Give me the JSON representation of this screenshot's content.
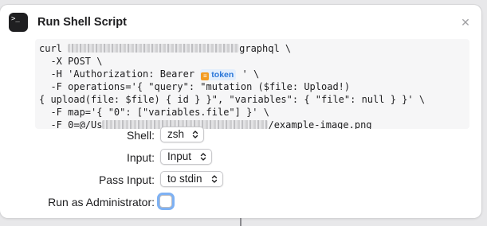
{
  "action": {
    "icon": "terminal-icon",
    "icon_glyph": ">_",
    "title": "Run Shell Script",
    "close_glyph": "✕"
  },
  "script": {
    "line1_pre": "curl ",
    "line1_post": "graphql \\",
    "line2": "  -X POST \\",
    "line3_pre": "  -H 'Authorization: Bearer ",
    "token_label": "token",
    "token_color": "#2a76d8",
    "line3_post": " ' \\",
    "line4": "  -F operations='{ \"query\": \"mutation ($file: Upload!)",
    "line5": "{ upload(file: $file) { id } }\", \"variables\": { \"file\": null } }' \\",
    "line6": "  -F map='{ \"0\": [\"variables.file\"] }' \\",
    "line7_pre": "  -F 0=@/Us",
    "line7_post": "/example-image.png"
  },
  "options": {
    "shell_label": "Shell:",
    "shell_value": "zsh",
    "input_label": "Input:",
    "input_value": "Input",
    "pass_input_label": "Pass Input:",
    "pass_input_value": "to stdin",
    "admin_label": "Run as Administrator:",
    "admin_checked": false
  },
  "colors": {
    "focus_ring": "#7eb1f3",
    "token_badge": "#f39c23"
  }
}
